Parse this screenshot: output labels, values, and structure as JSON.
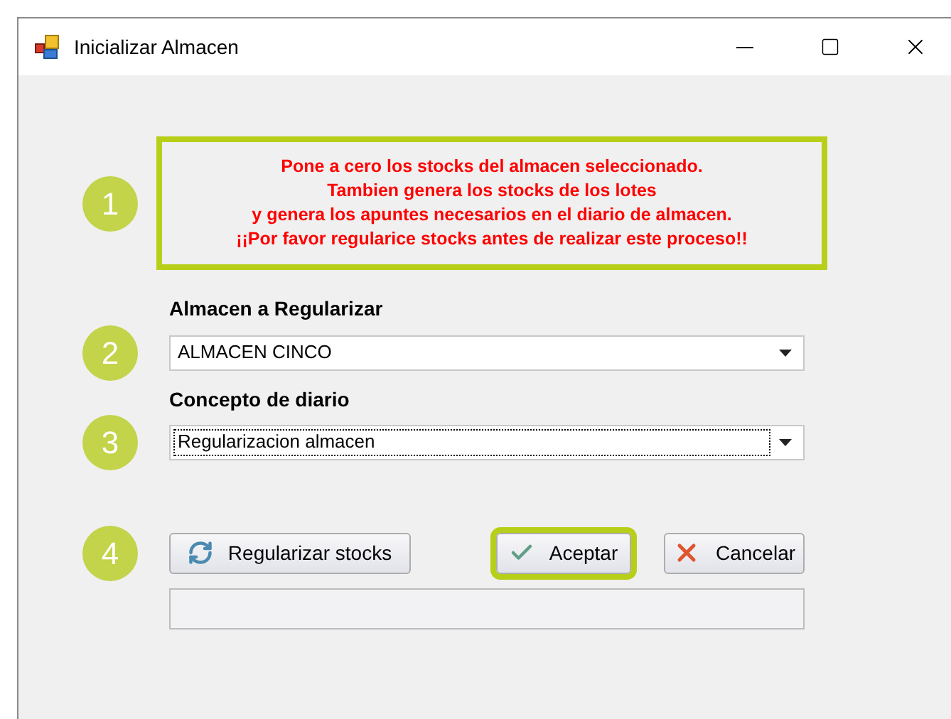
{
  "window": {
    "title": "Inicializar Almacen"
  },
  "notice": {
    "step": "1",
    "highlighted": true,
    "lines": [
      "Pone a cero los stocks del almacen seleccionado.",
      "Tambien genera los stocks de los lotes",
      "y genera los apuntes necesarios en el diario de almacen.",
      "¡¡Por favor regularice stocks antes de realizar este proceso!!"
    ]
  },
  "fields": [
    {
      "step": "2",
      "label": "Almacen a Regularizar",
      "value": "ALMACEN CINCO",
      "focused": false
    },
    {
      "step": "3",
      "label": "Concepto de diario",
      "value": "Regularizacion almacen",
      "focused": true
    }
  ],
  "actions": {
    "step": "4",
    "buttons": [
      {
        "kind": "refresh",
        "label": "Regularizar stocks",
        "highlighted": false
      },
      {
        "kind": "accept",
        "label": "Aceptar",
        "highlighted": true
      },
      {
        "kind": "cancel",
        "label": "Cancelar",
        "highlighted": false
      }
    ]
  },
  "progress": {
    "level": 0
  }
}
